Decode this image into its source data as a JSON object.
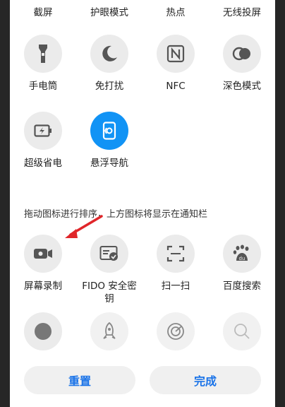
{
  "top_row": [
    {
      "label": "截屏"
    },
    {
      "label": "护眼模式"
    },
    {
      "label": "热点"
    },
    {
      "label": "无线投屏"
    }
  ],
  "enabled_tiles": [
    {
      "label": "手电筒",
      "icon": "flashlight-icon"
    },
    {
      "label": "免打扰",
      "icon": "moon-icon"
    },
    {
      "label": "NFC",
      "icon": "nfc-icon"
    },
    {
      "label": "深色模式",
      "icon": "dark-mode-icon"
    },
    {
      "label": "超级省电",
      "icon": "battery-saver-icon"
    },
    {
      "label": "悬浮导航",
      "icon": "floating-nav-icon",
      "active": true
    }
  ],
  "hint": "拖动图标进行排序，上方图标将显示在通知栏",
  "available_tiles": [
    {
      "label": "屏幕录制",
      "icon": "screen-record-icon"
    },
    {
      "label": "FIDO 安全密钥",
      "icon": "fido-key-icon"
    },
    {
      "label": "扫一扫",
      "icon": "scan-icon"
    },
    {
      "label": "百度搜索",
      "icon": "baidu-icon"
    },
    {
      "label": "",
      "icon": "circle-icon"
    },
    {
      "label": "",
      "icon": "rocket-icon"
    },
    {
      "label": "",
      "icon": "radar-icon"
    },
    {
      "label": "",
      "icon": "search-icon"
    }
  ],
  "buttons": {
    "reset": "重置",
    "done": "完成"
  },
  "colors": {
    "accent": "#1193f5",
    "tile_bg": "#ebebeb",
    "arrow": "#e0262a",
    "button_text": "#1a73e8"
  }
}
